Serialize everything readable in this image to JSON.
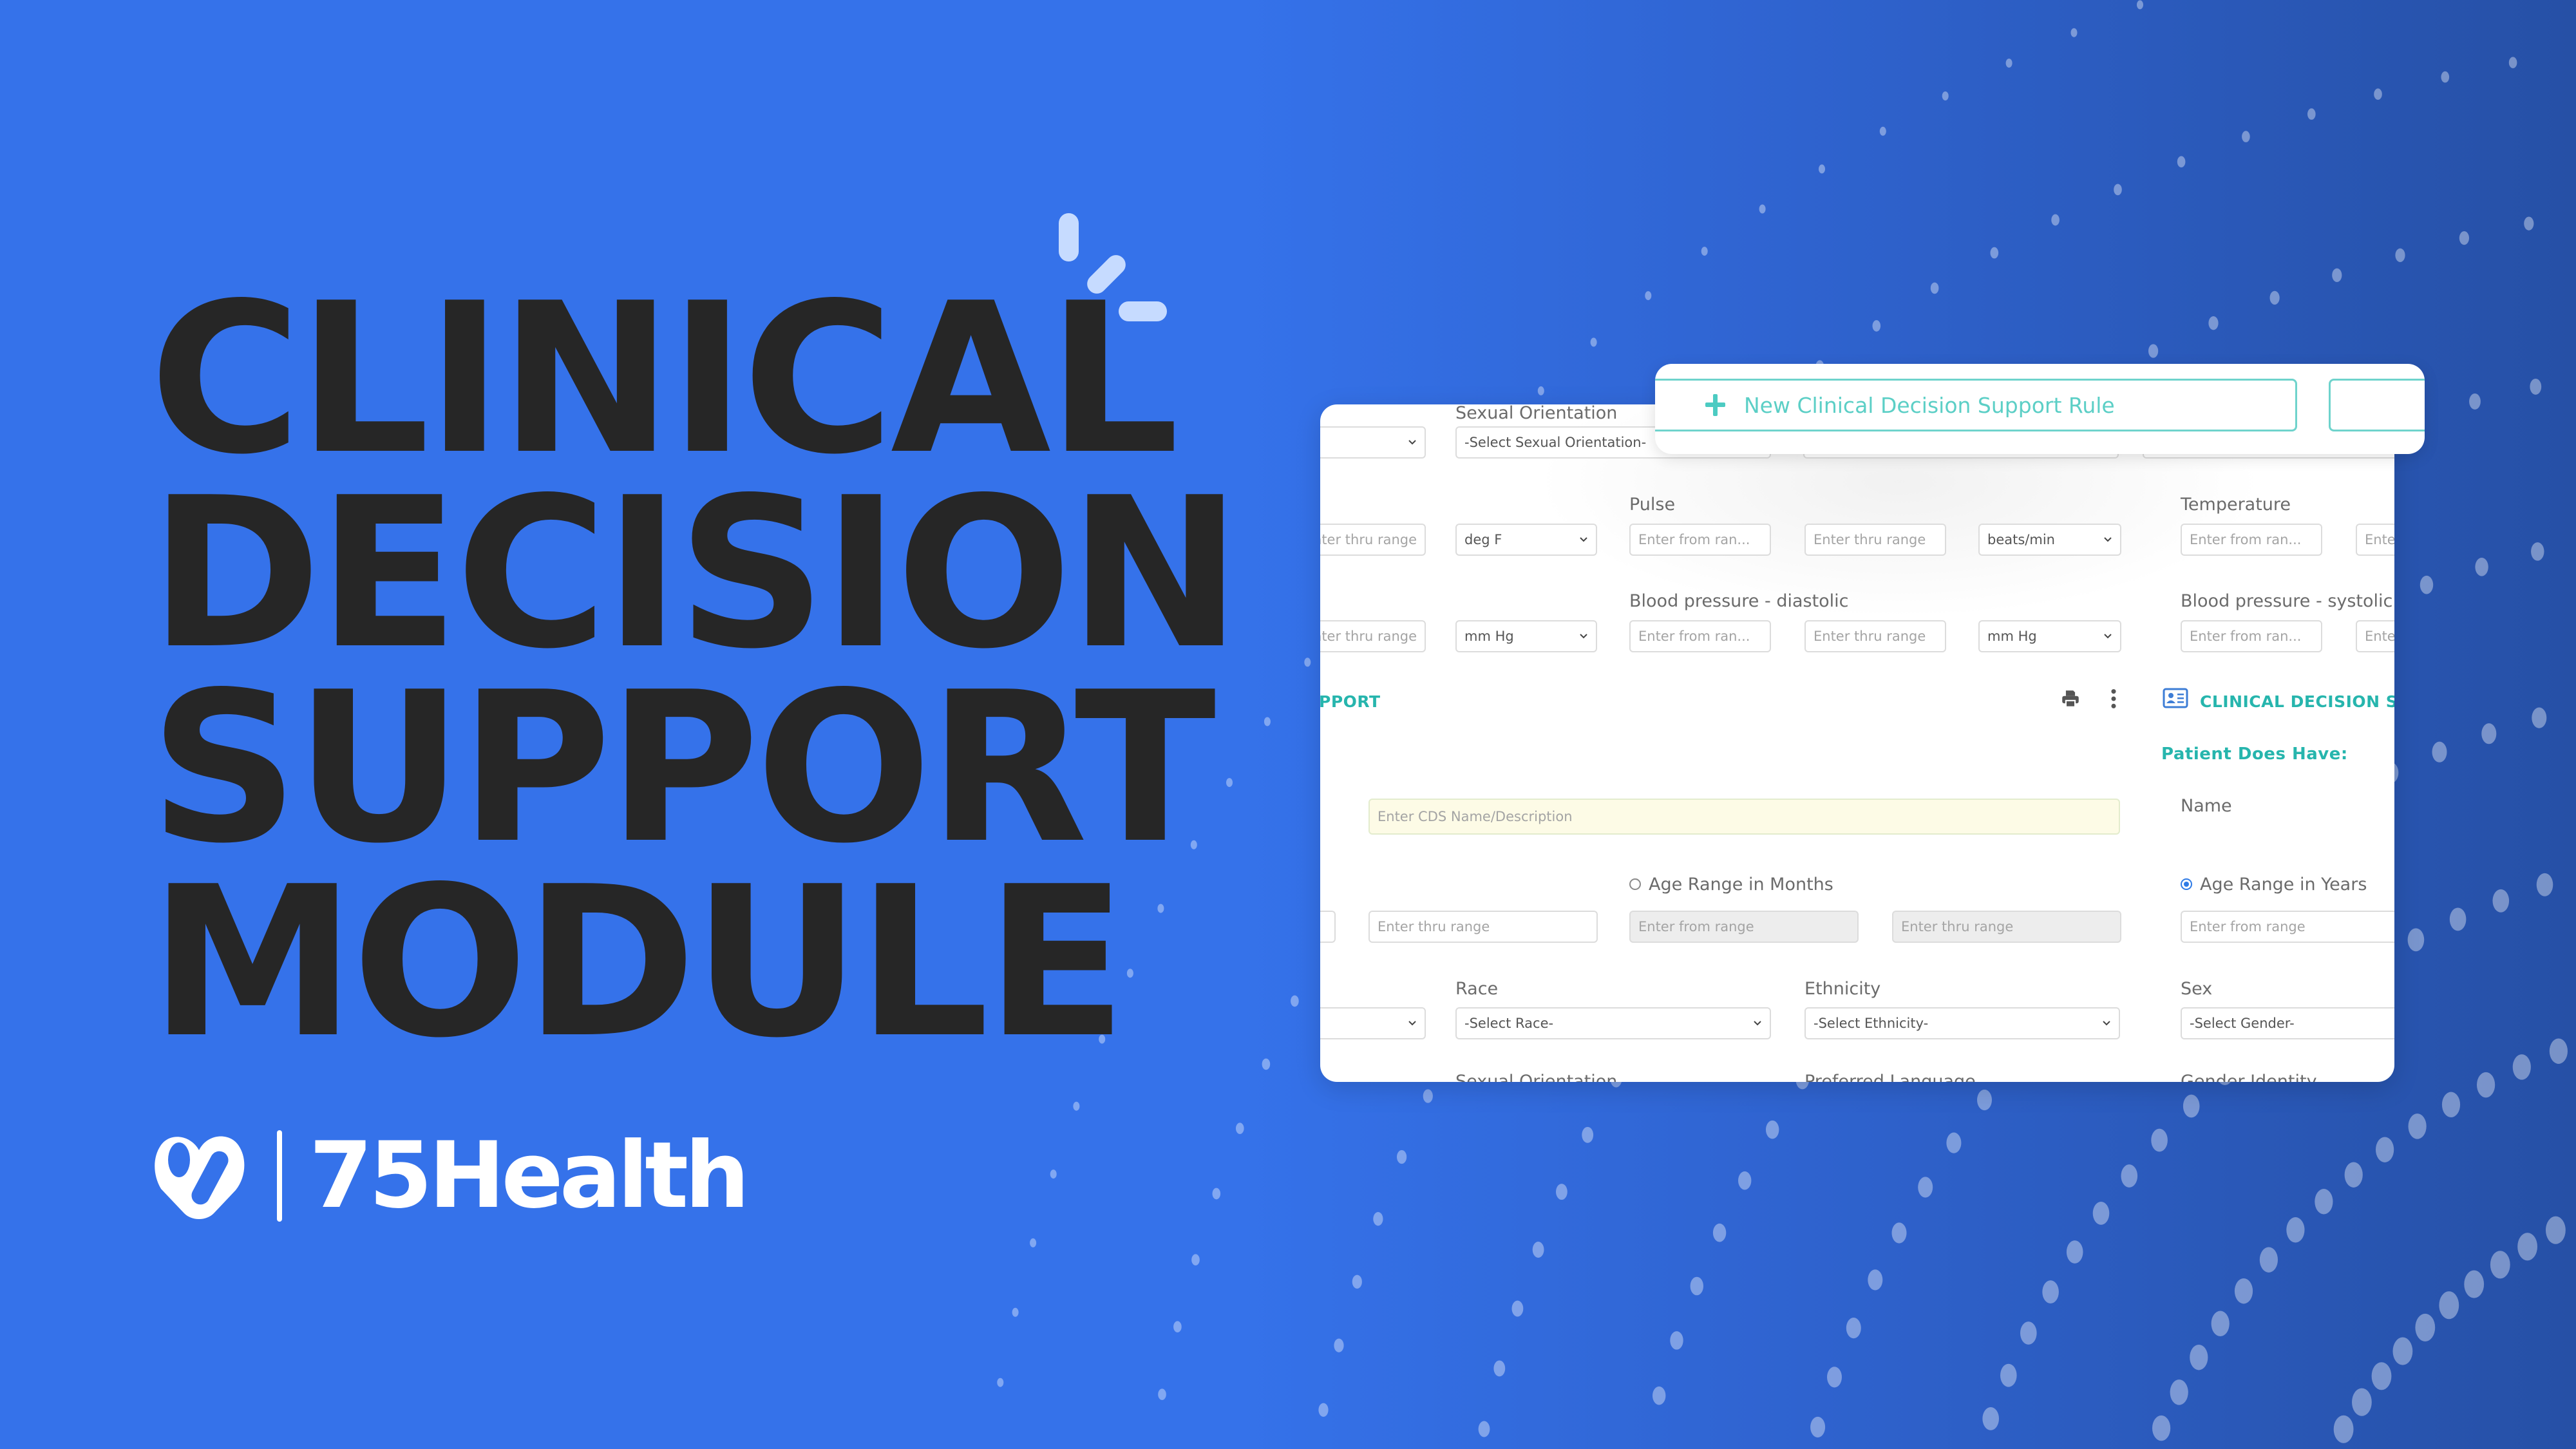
{
  "headline": {
    "lines": [
      "CLINICAL",
      "DECISION",
      "SUPPORT",
      "MODULE"
    ]
  },
  "brand": {
    "name": "75Health",
    "colors": {
      "background_left": "#3572ea",
      "background_right": "#2650a6",
      "headline_text": "#262626",
      "accent_teal": "#26b5ad",
      "spark": "#c6dbff"
    }
  },
  "floating_card": {
    "new_rule_button": "New Clinical Decision Support Rule",
    "plus_icon": "plus-icon"
  },
  "form": {
    "row1": {
      "label": "Sexual Orientation",
      "left_select_value": "",
      "select_value": "-Select Sexual Orientation-"
    },
    "row2": {
      "left_thru_placeholder": "Enter thru range",
      "left_unit": "deg F",
      "pulse_label": "Pulse",
      "pulse_from_placeholder": "Enter from ran...",
      "pulse_thru_placeholder": "Enter thru range",
      "pulse_unit": "beats/min",
      "temperature_label": "Temperature",
      "temperature_from_placeholder": "Enter from ran...",
      "temperature_thru_placeholder": "Ente"
    },
    "row3": {
      "left_thru_placeholder": "Enter thru range",
      "left_unit": "mm Hg",
      "diastolic_label": "Blood pressure - diastolic",
      "diastolic_from_placeholder": "Enter from ran...",
      "diastolic_thru_placeholder": "Enter thru range",
      "diastolic_unit": "mm Hg",
      "systolic_label": "Blood pressure - systolic",
      "systolic_from_placeholder": "Enter from ran...",
      "systolic_thru_placeholder": "Ente"
    },
    "toolbar": {
      "left_section_title": "PPORT",
      "print_icon": "print-icon",
      "more_icon": "more-vertical-icon",
      "right_section_icon": "id-card-icon",
      "right_section_title": "CLINICAL DECISION SUPPORT"
    },
    "patient_does_have": "Patient Does Have:",
    "cds_name_placeholder": "Enter CDS Name/Description",
    "name_label": "Name",
    "age": {
      "left_thru_placeholder": "Enter thru range",
      "months_label": "Age Range in Months",
      "months_selected": false,
      "months_from_placeholder": "Enter from range",
      "months_thru_placeholder": "Enter thru range",
      "years_label": "Age Range in Years",
      "years_selected": true,
      "years_from_placeholder": "Enter from range"
    },
    "demographics": {
      "race_label": "Race",
      "race_value": "-Select Race-",
      "ethnicity_label": "Ethnicity",
      "ethnicity_value": "-Select Ethnicity-",
      "sex_label": "Sex",
      "sex_value": "-Select Gender-"
    },
    "cut_labels": [
      "Sexual Orientation",
      "Preferred Language",
      "Gender Identity"
    ]
  }
}
